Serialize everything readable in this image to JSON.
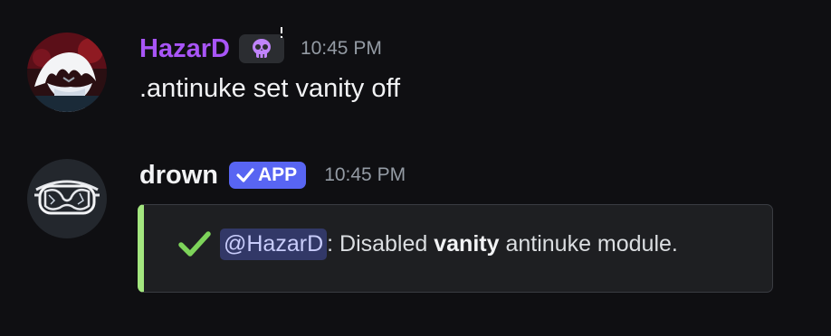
{
  "messages": [
    {
      "author": "HazarD",
      "timestamp": "10:45 PM",
      "content": ".antinuke set vanity off"
    },
    {
      "author": "drown",
      "badge": "APP",
      "timestamp": "10:45 PM",
      "embed": {
        "mention": "@HazarD",
        "text_before": ": Disabled ",
        "bold_text": "vanity",
        "text_after": " antinuke module.",
        "accent_color": "#a3e67f"
      }
    }
  ],
  "colors": {
    "username_1": "#a855f7",
    "app_badge": "#5865f2",
    "mention_bg": "#323867",
    "check": "#7dd35a",
    "background": "#0f0f12"
  },
  "icons": {
    "role_icon": "skull-icon",
    "badge_icon": "checkmark-icon",
    "embed_icon": "checkmark-icon"
  }
}
